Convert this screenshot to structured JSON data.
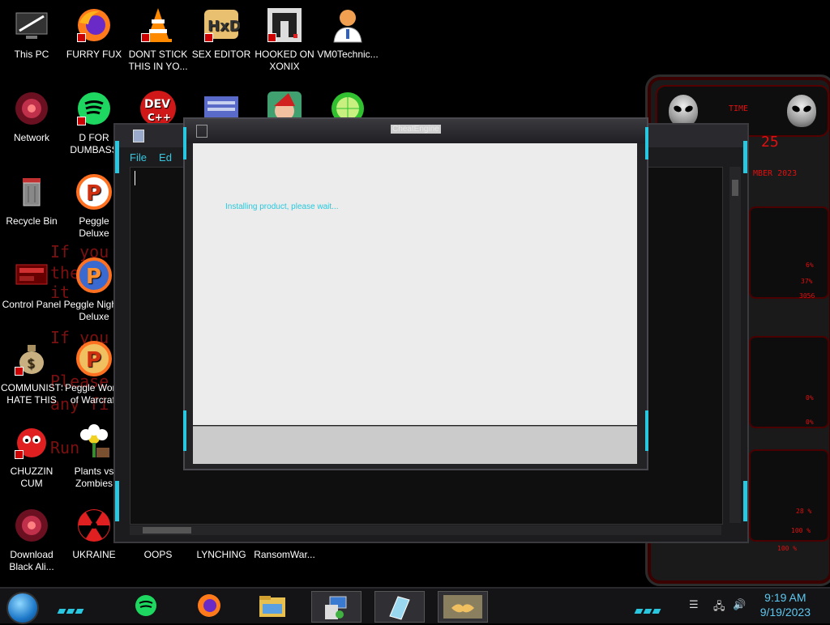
{
  "desktop_icons": [
    {
      "label": "This PC",
      "icon": "computer-icon",
      "color": "#555555"
    },
    {
      "label": "FURRY FUX",
      "icon": "firefox-icon",
      "color": "#ff7a1a"
    },
    {
      "label": "DONT STICK THIS IN YO...",
      "icon": "traffic-cone-icon",
      "color": "#ff8a00"
    },
    {
      "label": "SEX EDITOR",
      "icon": "hxd-editor-icon",
      "color": "#e8c070"
    },
    {
      "label": "HOOKED ON XONIX",
      "icon": "xonix-game-icon",
      "color": "#dddddd"
    },
    {
      "label": "VM0Technic...",
      "icon": "doctor-icon",
      "color": "#f0a050"
    },
    {
      "label": "Network",
      "icon": "network-icon",
      "color": "#c0304a"
    },
    {
      "label": "D FOR DUMBASS",
      "icon": "spotify-icon",
      "color": "#1ed760"
    },
    {
      "label": "Recycle Bin",
      "icon": "recycle-bin-icon",
      "color": "#d04040"
    },
    {
      "label": "Peggle Deluxe",
      "icon": "peggle-icon",
      "color": "#ff7020"
    },
    {
      "label": "Control Panel",
      "icon": "control-panel-icon",
      "color": "#c02020"
    },
    {
      "label": "Peggle Nights Deluxe",
      "icon": "peggle-nights-icon",
      "color": "#ff7020"
    },
    {
      "label": "COMMUNISTS HATE THIS G...",
      "icon": "money-bag-icon",
      "color": "#c8b080"
    },
    {
      "label": "Peggle World of Warcraft",
      "icon": "peggle-wow-icon",
      "color": "#ff7020"
    },
    {
      "label": "CHUZZIN CUM",
      "icon": "chuzzle-icon",
      "color": "#e02020"
    },
    {
      "label": "Plants vs Zombies",
      "icon": "pvz-flower-icon",
      "color": "#ffffff"
    },
    {
      "label": "Download Black Ali...",
      "icon": "alien-download-icon",
      "color": "#c0304a"
    },
    {
      "label": "UKRAINE",
      "icon": "radiation-icon",
      "color": "#e02020"
    },
    {
      "label": "OOPS",
      "icon": "generic-app-icon",
      "color": "#444444"
    },
    {
      "label": "LYNCHING",
      "icon": "generic-app-icon",
      "color": "#444444"
    },
    {
      "label": "RansomWar...",
      "icon": "generic-app-icon",
      "color": "#444444"
    },
    {
      "label": "",
      "icon": "dev-cpp-icon",
      "color": "#d01818"
    },
    {
      "label": "",
      "icon": "window-app-icon",
      "color": "#5a6ac8"
    },
    {
      "label": "",
      "icon": "santa-icon",
      "color": "#40a070"
    },
    {
      "label": "",
      "icon": "lime-icon",
      "color": "#30c030"
    }
  ],
  "background_text": [
    "If you",
    "the v",
    "it",
    "If you",
    "Please",
    "any fi",
    "Run"
  ],
  "notepad": {
    "menu": [
      "File",
      "Ed"
    ]
  },
  "installer": {
    "title": "CheatEngine",
    "message": "Installing product, please wait..."
  },
  "gadget": {
    "title_text": "TIME",
    "date_text": "MBER 2023",
    "clock_digits": "25",
    "stats": [
      "6%",
      "37%",
      "3056",
      "0%",
      "0%",
      "28 %",
      "100 %",
      "100 %"
    ]
  },
  "taskbar": {
    "items": [
      {
        "name": "spotify-taskbar",
        "icon": "spotify-icon"
      },
      {
        "name": "firefox-taskbar",
        "icon": "firefox-icon"
      },
      {
        "name": "file-explorer-taskbar",
        "icon": "folder-icon"
      },
      {
        "name": "installer-taskbar",
        "icon": "installer-icon"
      },
      {
        "name": "notepad-taskbar",
        "icon": "notepad-icon"
      },
      {
        "name": "handshake-taskbar",
        "icon": "handshake-icon"
      }
    ],
    "time": "9:19 AM",
    "date": "9/19/2023"
  },
  "colors": {
    "accent_cyan": "#29c8e0",
    "alien_red": "#e01010",
    "clock_blue": "#5ec8f0"
  }
}
